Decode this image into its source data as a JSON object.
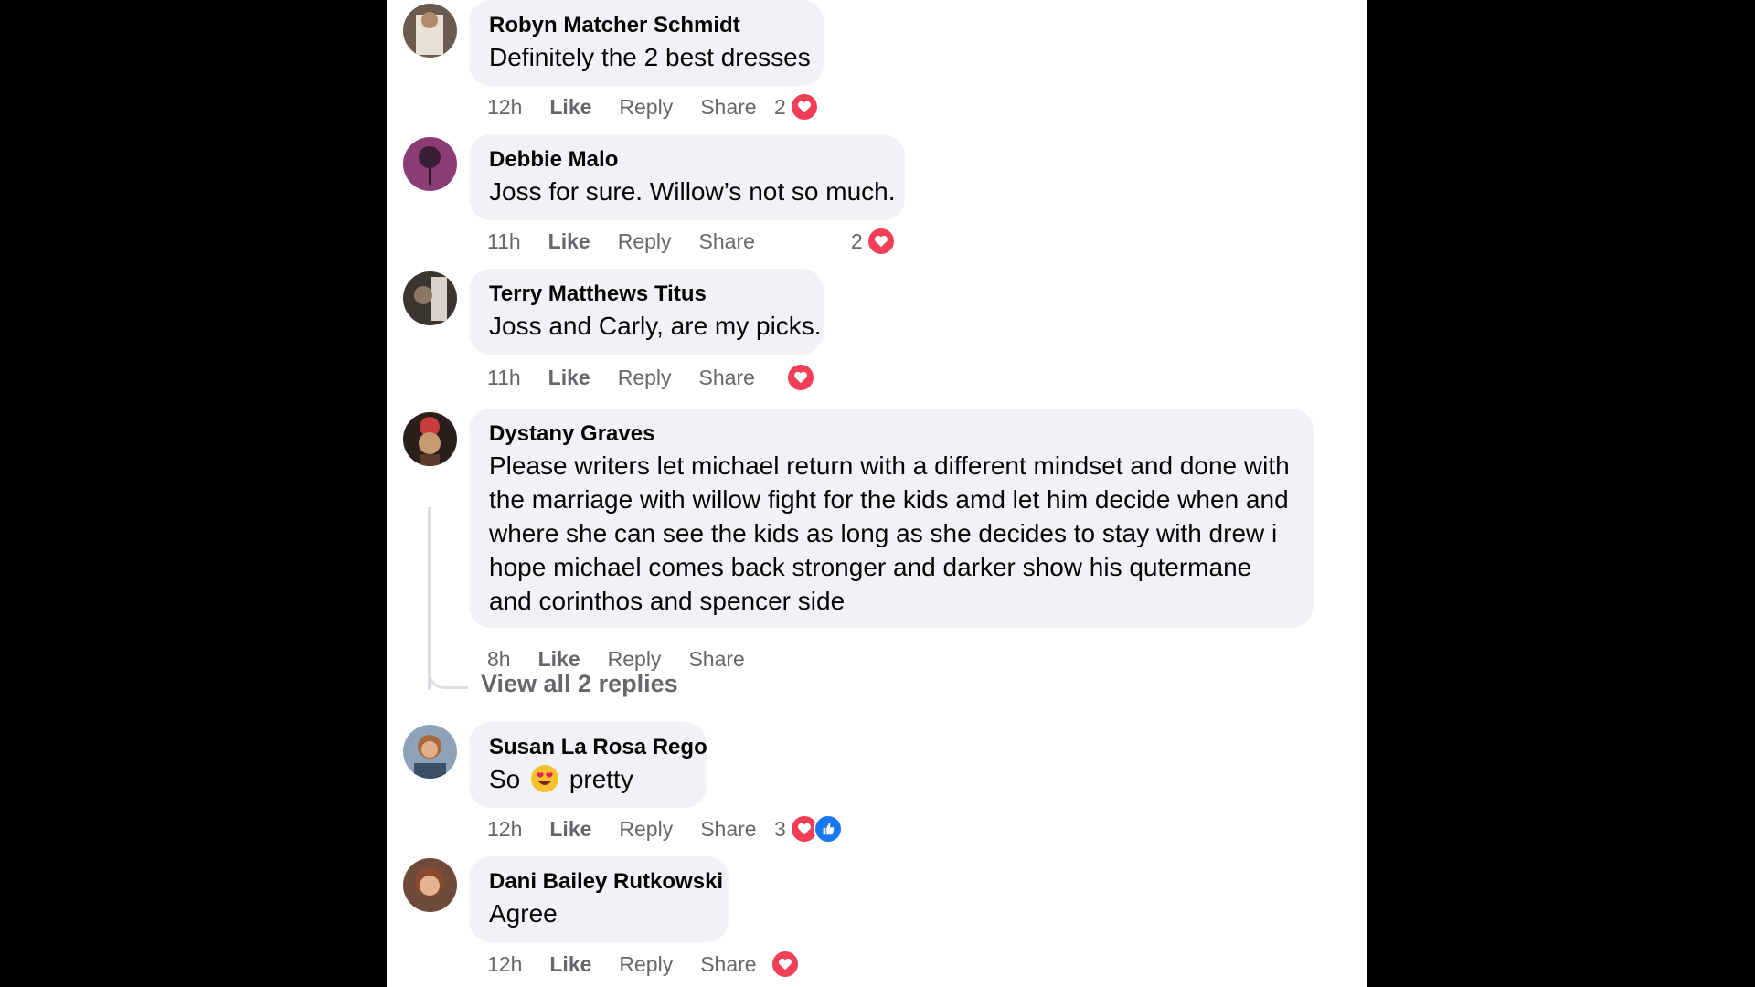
{
  "comments": [
    {
      "author": "Robyn Matcher Schmidt",
      "text": "Definitely the 2 best dresses",
      "time": "12h",
      "like": "Like",
      "reply": "Reply",
      "share": "Share",
      "reaction_count": "2",
      "reactions": [
        "love"
      ]
    },
    {
      "author": "Debbie Malo",
      "text": "Joss for sure. Willow’s not so much.",
      "time": "11h",
      "like": "Like",
      "reply": "Reply",
      "share": "Share",
      "reaction_count": "2",
      "reactions": [
        "love"
      ]
    },
    {
      "author": "Terry Matthews Titus",
      "text": "Joss and Carly, are my picks.",
      "time": "11h",
      "like": "Like",
      "reply": "Reply",
      "share": "Share",
      "reaction_count": "",
      "reactions": [
        "love"
      ]
    },
    {
      "author": "Dystany Graves",
      "text": "Please writers let michael return with a different mindset and done with the marriage with willow fight for the kids amd let him decide when and where she can see the kids as long as she decides to stay with drew i hope michael comes back stronger and darker show his qutermane and corinthos and spencer side",
      "time": "8h",
      "like": "Like",
      "reply": "Reply",
      "share": "Share",
      "view_replies": "View all 2 replies"
    },
    {
      "author": "Susan La Rosa Rego",
      "text_before": "So",
      "text_after": "pretty",
      "emoji": "heart-eyes-emoji",
      "time": "12h",
      "like": "Like",
      "reply": "Reply",
      "share": "Share",
      "reaction_count": "3",
      "reactions": [
        "love",
        "like"
      ]
    },
    {
      "author": "Dani Bailey Rutkowski",
      "text": "Agree",
      "time": "12h",
      "like": "Like",
      "reply": "Reply",
      "share": "Share",
      "reaction_count": "",
      "reactions": [
        "love"
      ]
    }
  ],
  "colors": {
    "bubble": "#f0f2f5",
    "meta_text": "#65676b",
    "love": "#f33e58",
    "like": "#1877f2"
  }
}
